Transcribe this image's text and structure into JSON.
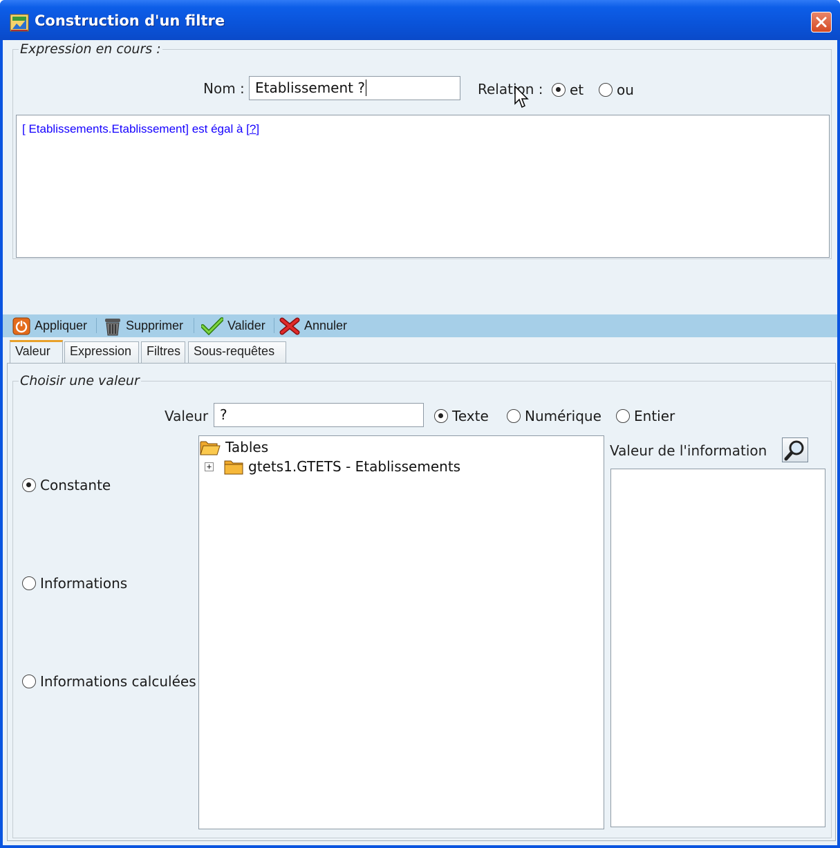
{
  "window": {
    "title": "Construction d'un filtre"
  },
  "expression_group": {
    "legend": "Expression en cours :",
    "name_label": "Nom :",
    "name_value": "Etablissement ?",
    "relation_label": "Relation :",
    "relation_options": [
      {
        "label": "et",
        "selected": true
      },
      {
        "label": "ou",
        "selected": false
      }
    ],
    "expression": {
      "open_bracket": "[ ",
      "field": "Etablissements.Etablissement",
      "close_bracket": "]",
      "operator": " est égal à ",
      "value_open": "[",
      "value": "?",
      "value_close": "]"
    }
  },
  "toolbar": {
    "items": [
      {
        "label": "Appliquer",
        "icon": "power-icon"
      },
      {
        "label": "Supprimer",
        "icon": "trash-icon"
      },
      {
        "label": "Valider",
        "icon": "checkmark-icon"
      },
      {
        "label": "Annuler",
        "icon": "cross-icon"
      }
    ]
  },
  "tabs": [
    {
      "label": "Valeur",
      "active": true
    },
    {
      "label": "Expression",
      "active": false
    },
    {
      "label": "Filtres",
      "active": false
    },
    {
      "label": "Sous-requêtes",
      "active": false
    }
  ],
  "value_group": {
    "legend": "Choisir une valeur",
    "value_label": "Valeur",
    "value_input": "?",
    "type_options": [
      {
        "label": "Texte",
        "selected": true
      },
      {
        "label": "Numérique",
        "selected": false
      },
      {
        "label": "Entier",
        "selected": false
      }
    ],
    "source_options": [
      {
        "label": "Constante",
        "selected": true
      },
      {
        "label": "Informations",
        "selected": false
      },
      {
        "label": "Informations calculées",
        "selected": false
      }
    ],
    "tree": {
      "root": "Tables",
      "children": [
        {
          "label": "gtets1.GTETS - Etablissements",
          "expanded": false
        }
      ]
    },
    "info_value_label": "Valeur de l'information",
    "info_search_icon": "magnifier-icon"
  },
  "colors": {
    "titlebar": "#0a53d9",
    "client": "#ebf2f7",
    "toolbar": "#a6cfe8",
    "expression_link": "#1400ff",
    "active_tab_accent": "#e8a02a"
  }
}
